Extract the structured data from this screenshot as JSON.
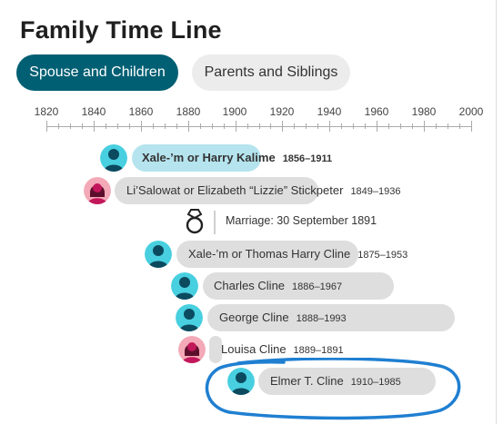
{
  "title": "Family Time Line",
  "tabs": [
    {
      "label": "Spouse and Children"
    },
    {
      "label": "Parents and Siblings"
    }
  ],
  "axis": {
    "ticks": [
      "1820",
      "1840",
      "1860",
      "1880",
      "1900",
      "1920",
      "1940",
      "1960",
      "1980",
      "2000"
    ]
  },
  "people": [
    {
      "name": "Xale-’m or Harry Kalime",
      "dates": "1856–1911",
      "gender": "male"
    },
    {
      "name": "Li’Salowat or Elizabeth “Lizzie” Stickpeter",
      "dates": "1849–1936",
      "gender": "female"
    },
    {
      "name": "Xale-’m or Thomas Harry Cline",
      "dates": "1875–1953",
      "gender": "male"
    },
    {
      "name": "Charles Cline",
      "dates": "1886–1967",
      "gender": "male"
    },
    {
      "name": "George Cline",
      "dates": "1888–1993",
      "gender": "male"
    },
    {
      "name": "Louisa Cline",
      "dates": "1889–1891",
      "gender": "female"
    },
    {
      "name": "Elmer T. Cline",
      "dates": "1910–1985",
      "gender": "male"
    }
  ],
  "marriage": {
    "label": "Marriage: 30 September 1891"
  },
  "colors": {
    "male_avatar_bg": "#48cfe0",
    "female_avatar_bg": "#f3a9b7",
    "active_tab": "#005f73",
    "focus_bar": "#b5e4ee",
    "highlight_stroke": "#1f7fd1"
  }
}
